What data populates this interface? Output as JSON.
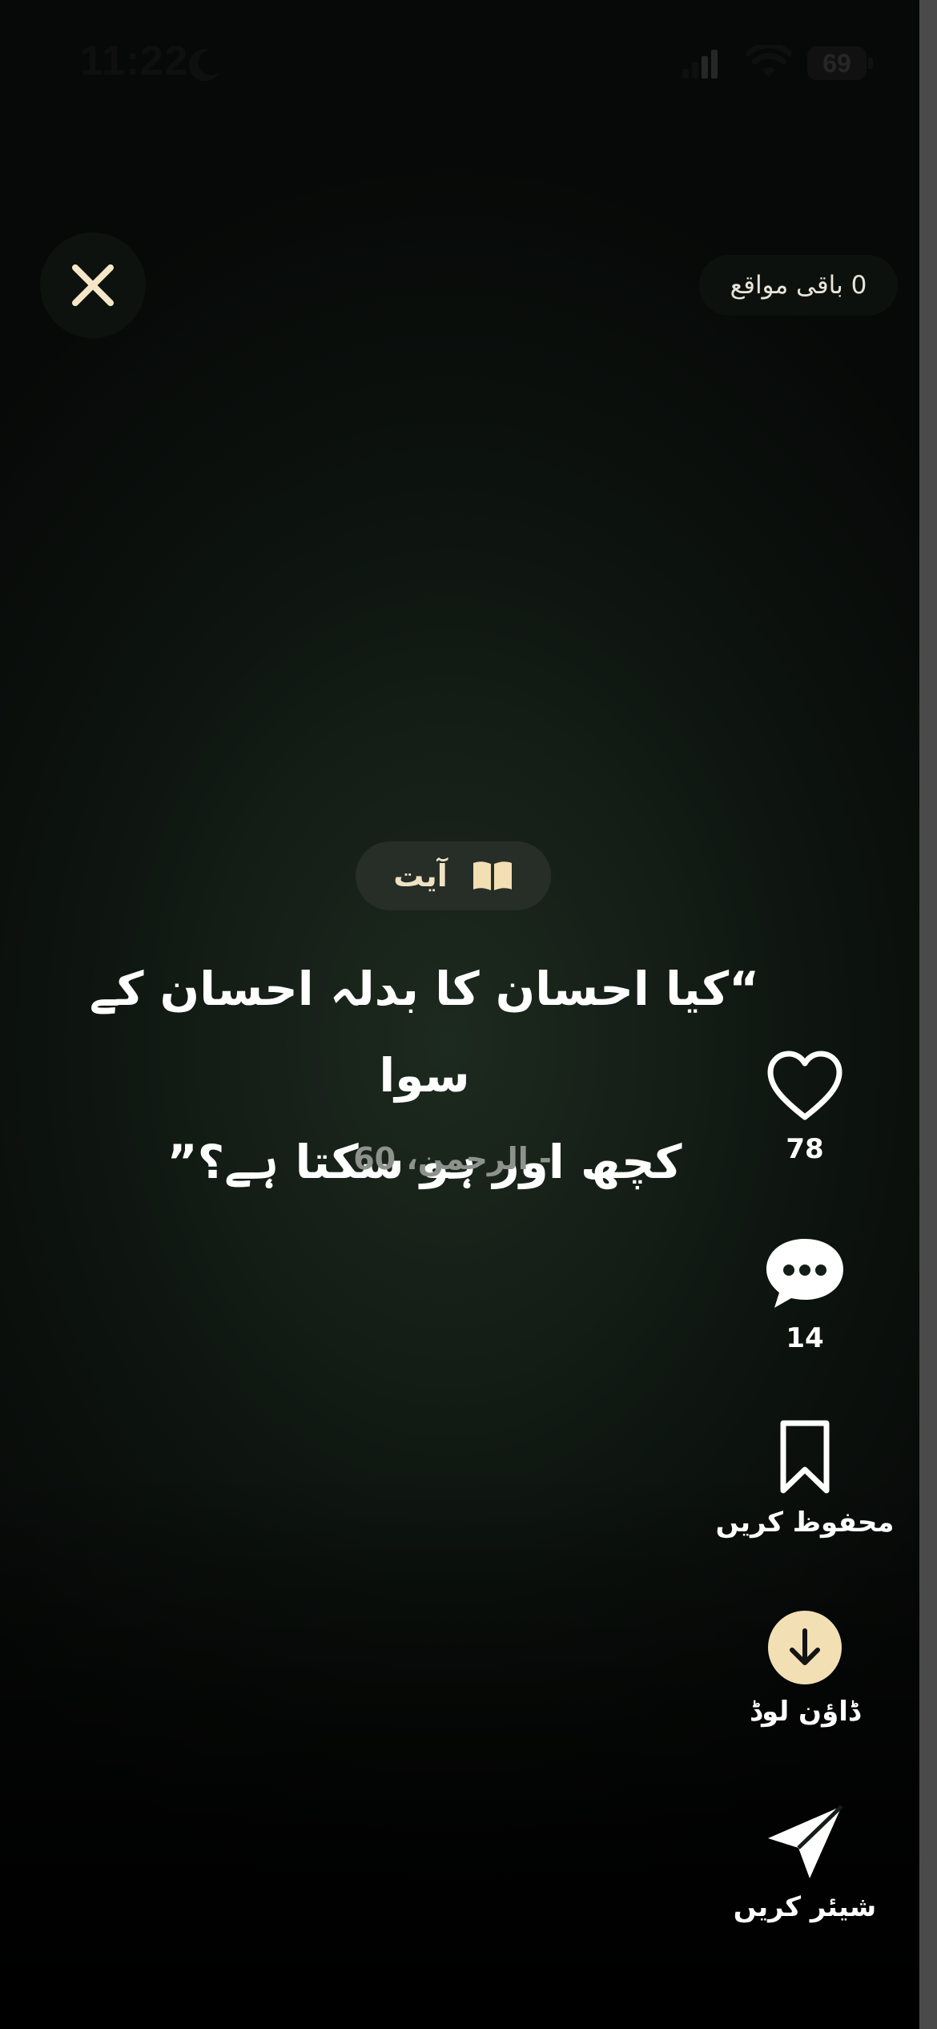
{
  "status_bar": {
    "time": "11:22",
    "battery": "69",
    "icons": [
      "moon-icon",
      "signal-icon",
      "wifi-icon",
      "battery-icon"
    ]
  },
  "header": {
    "close_icon": "close-icon",
    "remaining_label": "0 باقی مواقع"
  },
  "content": {
    "category_label": "آیت",
    "category_icon": "book-icon",
    "quote_line1": "“کیا احسان کا بدلہ احسان کے سوا",
    "quote_line2": "کچھ اور ہو سکتا ہے؟”",
    "reference": "الرحمن، 60 -"
  },
  "actions": {
    "like": {
      "icon": "heart-icon",
      "count": "78"
    },
    "comment": {
      "icon": "comment-icon",
      "count": "14"
    },
    "save": {
      "icon": "bookmark-icon",
      "label": "محفوظ کریں"
    },
    "download": {
      "icon": "download-icon",
      "label": "ڈاؤن لوڈ"
    },
    "share": {
      "icon": "send-icon",
      "label": "شیئر کریں"
    }
  },
  "colors": {
    "accent": "#f2dfb4",
    "text": "#ffffff",
    "muted": "#8e928c",
    "background": "#141d16"
  }
}
